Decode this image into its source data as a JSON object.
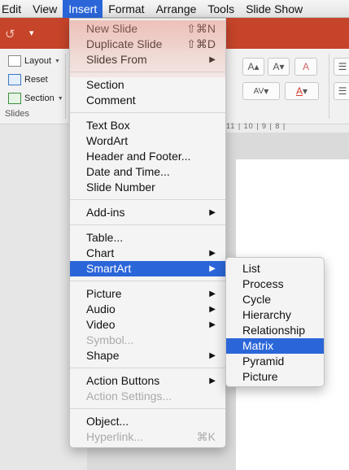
{
  "menubar": {
    "items": [
      "Edit",
      "View",
      "Insert",
      "Format",
      "Arrange",
      "Tools",
      "Slide Show"
    ],
    "active_index": 2
  },
  "titlebar": {
    "undo_icon": "undo-icon",
    "qa_icon": "customize-toolbar-icon"
  },
  "ribbon": {
    "layout_label": "Layout",
    "reset_label": "Reset",
    "section_label": "Section",
    "group_label": "Slides",
    "grow_font": "A",
    "shrink_font": "A",
    "clear_format": "A",
    "char_spacing": "AV",
    "font_color": "A",
    "ruler_text": "11 | 10 | 9 | 8 |"
  },
  "insert_menu": {
    "new_slide": "New Slide",
    "new_slide_shortcut": "⇧⌘N",
    "duplicate_slide": "Duplicate Slide",
    "duplicate_slide_shortcut": "⇧⌘D",
    "slides_from": "Slides From",
    "section": "Section",
    "comment": "Comment",
    "text_box": "Text Box",
    "wordart": "WordArt",
    "header_footer": "Header and Footer...",
    "date_time": "Date and Time...",
    "slide_number": "Slide Number",
    "add_ins": "Add-ins",
    "table": "Table...",
    "chart": "Chart",
    "smartart": "SmartArt",
    "picture": "Picture",
    "audio": "Audio",
    "video": "Video",
    "symbol": "Symbol...",
    "shape": "Shape",
    "action_buttons": "Action Buttons",
    "action_settings": "Action Settings...",
    "object": "Object...",
    "hyperlink": "Hyperlink...",
    "hyperlink_shortcut": "⌘K",
    "submenu_arrow": "▶"
  },
  "smartart_menu": {
    "items": [
      "List",
      "Process",
      "Cycle",
      "Hierarchy",
      "Relationship",
      "Matrix",
      "Pyramid",
      "Picture"
    ],
    "highlighted_index": 5
  },
  "colors": {
    "highlight": "#2b66d9",
    "title_bar": "#c6442a"
  }
}
